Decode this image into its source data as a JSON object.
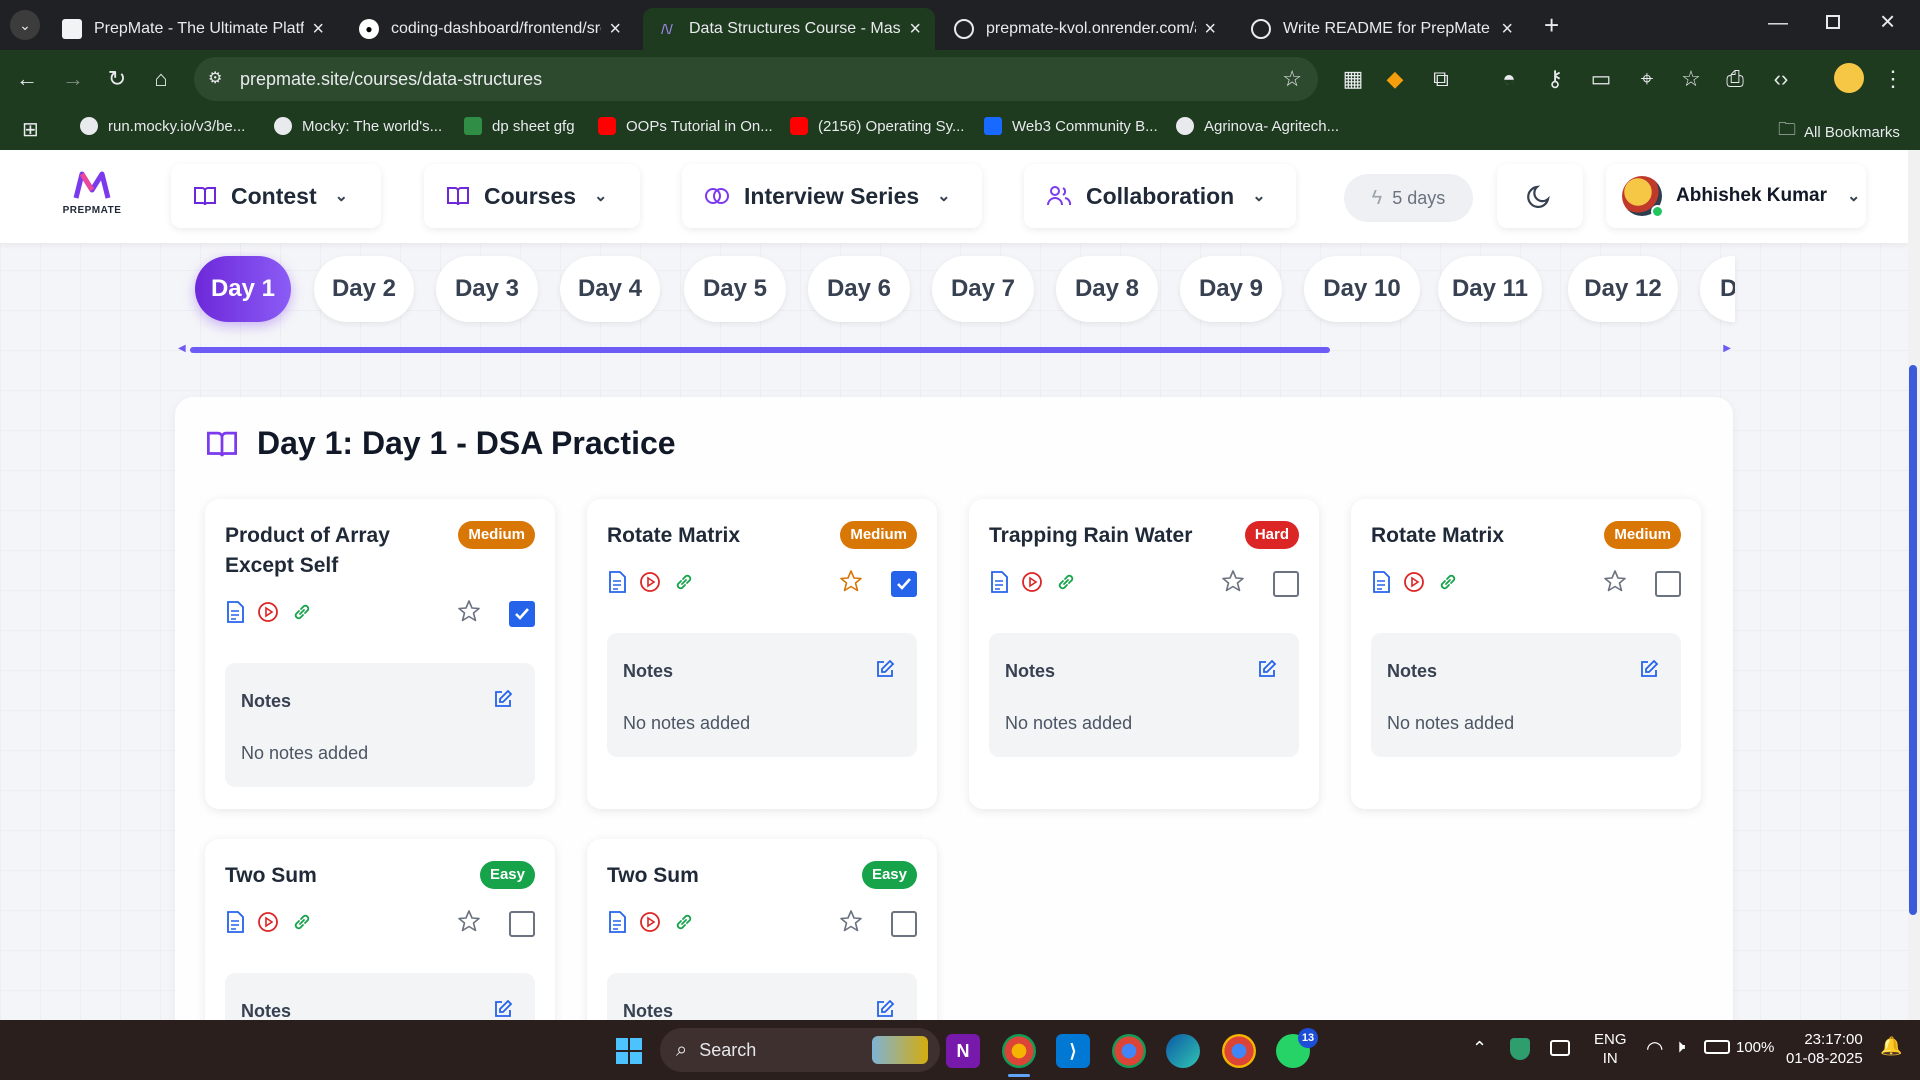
{
  "browser": {
    "tabs": [
      {
        "title": "PrepMate - The Ultimate Platfo",
        "active": false
      },
      {
        "title": "coding-dashboard/frontend/src",
        "active": false
      },
      {
        "title": "Data Structures Course - Master",
        "active": true
      },
      {
        "title": "prepmate-kvol.onrender.com/a",
        "active": false
      },
      {
        "title": "Write README for PrepMate",
        "active": false
      }
    ],
    "url_host": "prepmate.site",
    "url_path": "/courses/data-structures",
    "bookmarks": [
      "run.mocky.io/v3/be...",
      "Mocky: The world's...",
      "dp sheet gfg",
      "OOPs Tutorial in On...",
      "(2156) Operating Sy...",
      "Web3 Community B...",
      "Agrinova- Agritech..."
    ],
    "all_bookmarks": "All Bookmarks"
  },
  "navbar": {
    "logo_text": "PREPMATE",
    "items": [
      {
        "label": "Contest"
      },
      {
        "label": "Courses"
      },
      {
        "label": "Interview Series"
      },
      {
        "label": "Collaboration"
      }
    ],
    "streak": "5 days",
    "user_name": "Abhishek Kumar"
  },
  "days": [
    "Day 1",
    "Day 2",
    "Day 3",
    "Day 4",
    "Day 5",
    "Day 6",
    "Day 7",
    "Day 8",
    "Day 9",
    "Day 10",
    "Day 11",
    "Day 12",
    "D"
  ],
  "day_progress_fraction": 0.74,
  "day_heading": "Day 1: Day 1 - DSA Practice",
  "notes_label": "Notes",
  "no_notes": "No notes added",
  "problems": [
    {
      "name": "Product of Array Except Self",
      "difficulty": "Medium",
      "starred": false,
      "done": true
    },
    {
      "name": "Rotate Matrix",
      "difficulty": "Medium",
      "starred": true,
      "done": true
    },
    {
      "name": "Trapping Rain Water",
      "difficulty": "Hard",
      "starred": false,
      "done": false
    },
    {
      "name": "Rotate Matrix",
      "difficulty": "Medium",
      "starred": false,
      "done": false
    },
    {
      "name": "Two Sum",
      "difficulty": "Easy",
      "starred": false,
      "done": false
    },
    {
      "name": "Two Sum",
      "difficulty": "Easy",
      "starred": false,
      "done": false
    }
  ],
  "taskbar": {
    "search": "Search",
    "lang": "ENG",
    "region": "IN",
    "battery": "100%",
    "time": "23:17:00",
    "date": "01-08-2025",
    "whatsapp_badge": "13"
  },
  "colors": {
    "accent": "#7c3aed",
    "medium": "#d97706",
    "hard": "#dc2626",
    "easy": "#16a34a",
    "checkbox": "#2563eb"
  }
}
